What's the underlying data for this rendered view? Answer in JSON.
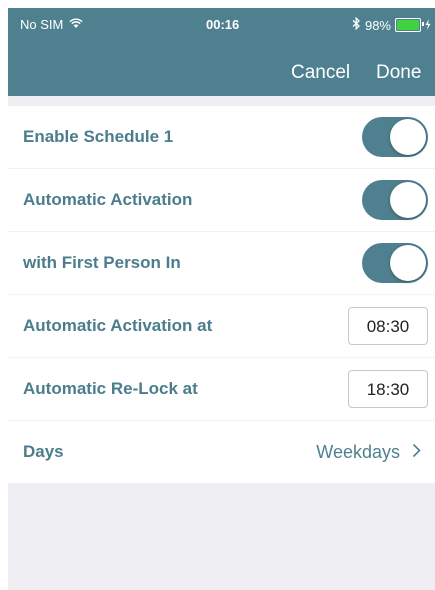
{
  "status_bar": {
    "carrier": "No SIM",
    "wifi_icon": "wifi-icon",
    "time": "00:16",
    "bluetooth_icon": "bluetooth-icon",
    "battery_percent": "98%",
    "battery_level": 0.98,
    "charging_icon": "charging-bolt-icon"
  },
  "nav": {
    "cancel_label": "Cancel",
    "done_label": "Done"
  },
  "settings": [
    {
      "label": "Enable Schedule 1",
      "type": "toggle",
      "on": true
    },
    {
      "label": "Automatic Activation",
      "type": "toggle",
      "on": true
    },
    {
      "label": "with First Person In",
      "type": "toggle",
      "on": true
    },
    {
      "label": "Automatic Activation at",
      "type": "time",
      "value": "08:30"
    },
    {
      "label": "Automatic Re-Lock at",
      "type": "time",
      "value": "18:30"
    },
    {
      "label": "Days",
      "type": "disclosure",
      "value": "Weekdays"
    }
  ],
  "colors": {
    "accent": "#4f8090",
    "label_text": "#4c7d8d",
    "background": "#efeff3",
    "battery_green": "#3fd23f"
  }
}
